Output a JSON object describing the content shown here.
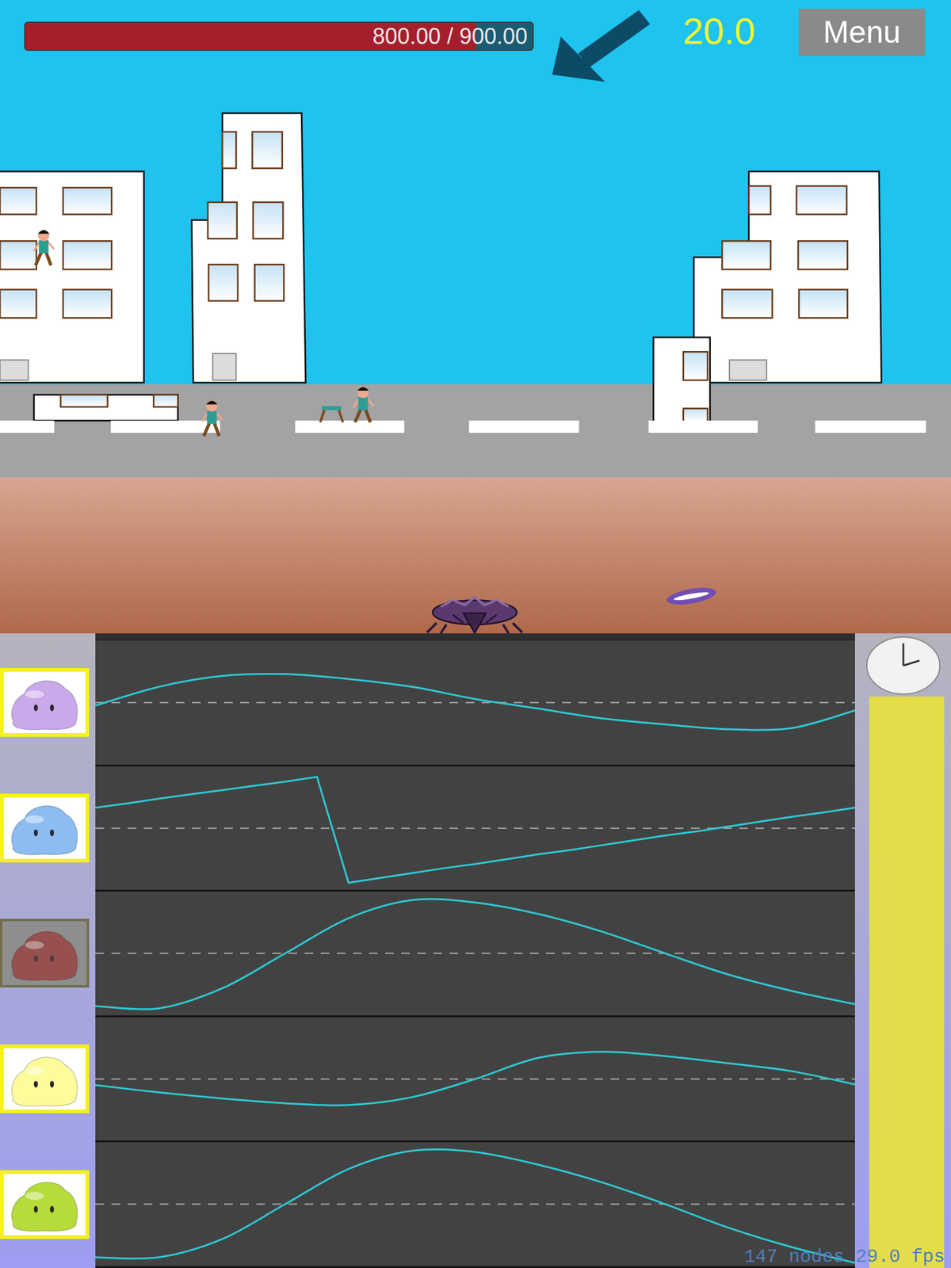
{
  "hud": {
    "health": {
      "reading": "800.00 / 900.00",
      "level": 0.889
    },
    "score": "20.0",
    "menu_button": "Menu"
  },
  "lanes": [
    {
      "color": "#c9a9ea",
      "selected": true,
      "kind": "smooth",
      "values": [
        -0.05,
        0.26,
        0.44,
        0.47,
        0.39,
        0.26,
        0.06,
        -0.1,
        -0.26,
        -0.36,
        -0.44,
        -0.42,
        -0.13
      ]
    },
    {
      "color": "#8cbcf2",
      "selected": true,
      "kind": "linear",
      "values": [
        0.34,
        0.41,
        0.49,
        0.56,
        0.63,
        0.7,
        0.77,
        0.85,
        -0.9,
        -0.82,
        -0.74,
        -0.66,
        -0.59,
        -0.51,
        -0.43,
        -0.36,
        -0.28,
        -0.2,
        -0.12,
        -0.05,
        0.03,
        0.11,
        0.19,
        0.26,
        0.34
      ]
    },
    {
      "color": "#9a3a3a",
      "selected": false,
      "kind": "smooth",
      "values": [
        -0.87,
        -0.91,
        -0.58,
        0.0,
        0.58,
        0.88,
        0.84,
        0.65,
        0.36,
        0.0,
        -0.35,
        -0.62,
        -0.84
      ]
    },
    {
      "color": "#fcfc9c",
      "selected": true,
      "kind": "smooth",
      "values": [
        -0.1,
        -0.22,
        -0.32,
        -0.4,
        -0.43,
        -0.3,
        0.0,
        0.35,
        0.45,
        0.38,
        0.26,
        0.13,
        -0.09
      ]
    },
    {
      "color": "#b5dc3a",
      "selected": true,
      "kind": "smooth",
      "values": [
        -0.88,
        -0.88,
        -0.58,
        0.0,
        0.58,
        0.88,
        0.86,
        0.65,
        0.36,
        0.0,
        -0.39,
        -0.71,
        -0.97
      ]
    }
  ],
  "timer": {
    "level": 1
  },
  "debug": "147 nodes 29.0 fps"
}
